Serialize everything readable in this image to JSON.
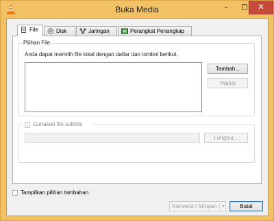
{
  "window": {
    "title": "Buka Media",
    "accent": "#f3c165",
    "close_color": "#c74a3b",
    "controls": {
      "minimize": "–",
      "maximize": "□",
      "close": "✕"
    },
    "app_icon": "vlc-cone-icon"
  },
  "tabs": [
    {
      "label": "File",
      "icon": "file-icon",
      "active": true
    },
    {
      "label": "Disk",
      "icon": "disc-icon",
      "active": false
    },
    {
      "label": "Jaringan",
      "icon": "network-icon",
      "active": false
    },
    {
      "label": "Perangkat Penangkap",
      "icon": "capture-device-icon",
      "active": false
    }
  ],
  "file_selection": {
    "group_label": "Pilihan File",
    "hint": "Anda dapat memilih file lokal dengan daftar dan tombol berikut.",
    "add_button": "Tambah...",
    "remove_button": "Hapus"
  },
  "subtitle": {
    "checkbox_label": "Gunakan file subtitle",
    "checked": false,
    "path_value": "",
    "browse_button": "Lungsur..."
  },
  "footer": {
    "show_more_label": "Tampilkan pilihan tambahan",
    "show_more_checked": false,
    "convert_button": "Konversi / Simpan",
    "convert_arrow": "▾",
    "cancel_button": "Batal"
  }
}
